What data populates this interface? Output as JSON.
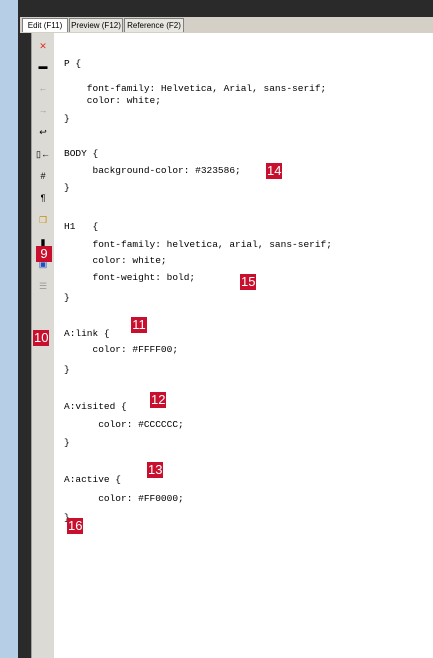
{
  "tabs": [
    {
      "label": "Edit (F11)"
    },
    {
      "label": "Preview (F12)"
    },
    {
      "label": "Reference (F2)"
    }
  ],
  "toolbar_icons": [
    {
      "name": "close-icon",
      "glyph": "✕",
      "color": "#e0301e"
    },
    {
      "name": "monitor-icon",
      "glyph": "▬",
      "color": "#000000"
    },
    {
      "name": "back-arrow-icon",
      "glyph": "←",
      "color": "#9a9a9a"
    },
    {
      "name": "forward-arrow-icon",
      "glyph": "→",
      "color": "#9a9a9a"
    },
    {
      "name": "word-wrap-icon",
      "glyph": "↩",
      "color": "#000000"
    },
    {
      "name": "insert-icon",
      "glyph": "▯←",
      "color": "#000000"
    },
    {
      "name": "hash-icon",
      "glyph": "#",
      "color": "#000000"
    },
    {
      "name": "pilcrow-icon",
      "glyph": "¶",
      "color": "#000000"
    },
    {
      "name": "copy-icon",
      "glyph": "❐",
      "color": "#c89000"
    },
    {
      "name": "paste-icon",
      "glyph": "▮",
      "color": "#000000"
    },
    {
      "name": "image-icon",
      "glyph": "▣",
      "color": "#2050c0"
    },
    {
      "name": "table-icon",
      "glyph": "☰",
      "color": "#9a9a9a"
    }
  ],
  "code_lines": [
    "P {",
    "    font-family: Helvetica, Arial, sans-serif;",
    "    color: white;",
    "}",
    "",
    "BODY {",
    "     background-color: #323586;",
    "}",
    "",
    "H1   {",
    "     font-family: helvetica, arial, sans-serif;",
    "     color: white;",
    "     font-weight: bold;",
    "}",
    "",
    "A:link {",
    "     color: #FFFF00;",
    "}",
    "",
    "A:visited {",
    "      color: #CCCCCC;",
    "}",
    "",
    "A:active {",
    "      color: #FF0000;",
    "}"
  ],
  "callouts": {
    "c9": "9",
    "c10": "10",
    "c11": "11",
    "c12": "12",
    "c13": "13",
    "c14": "14",
    "c15": "15",
    "c16": "16"
  },
  "colors": {
    "callout": "#c8102e",
    "background": "#b7cfe6",
    "toolbar": "#dcdad4"
  }
}
